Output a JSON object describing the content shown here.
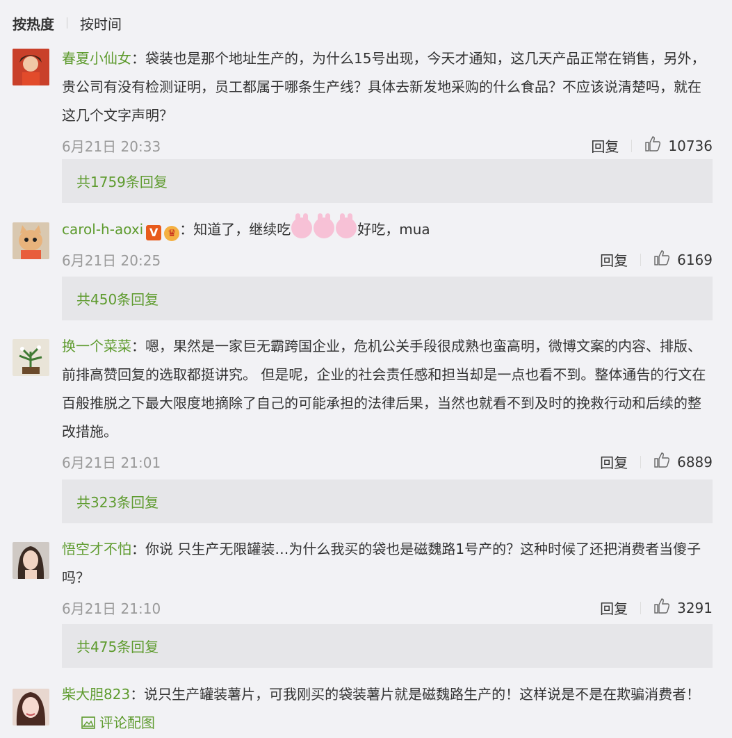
{
  "sort": {
    "active": "按热度",
    "inactive": "按时间"
  },
  "colors": {
    "username": "#5e9b2e",
    "background": "#f2f2f5",
    "reply_box": "#e6e6e9"
  },
  "comments": [
    {
      "user": "春夏小仙女",
      "text": "：袋装也是那个地址生产的，为什么15号出现，今天才通知，这几天产品正常在销售，另外，贵公司有没有检测证明，员工都属于哪条生产线？具体去新发地采购的什么食品？不应该说清楚吗，就在这几个文字声明？",
      "time": "6月21日 20:33",
      "reply_label": "回复",
      "likes": "10736",
      "replies": "共1759条回复"
    },
    {
      "user": "carol-h-aoxi",
      "text_before_emoji": "：知道了，继续吃",
      "text_after_emoji": "好吃，mua",
      "badge_v": "V",
      "time": "6月21日 20:25",
      "reply_label": "回复",
      "likes": "6169",
      "replies": "共450条回复"
    },
    {
      "user": "换一个菜菜",
      "text": "：嗯，果然是一家巨无霸跨国企业，危机公关手段很成熟也蛮高明，微博文案的内容、排版、前排高赞回复的选取都挺讲究。 但是呢，企业的社会责任感和担当却是一点也看不到。整体通告的行文在百般推脱之下最大限度地摘除了自己的可能承担的法律后果，当然也就看不到及时的挽救行动和后续的整改措施。",
      "time": "6月21日 21:01",
      "reply_label": "回复",
      "likes": "6889",
      "replies": "共323条回复"
    },
    {
      "user": "悟空才不怕",
      "text": "：你说 只生产无限罐装…为什么我买的袋也是磁魏路1号产的？这种时候了还把消费者当傻子吗？",
      "time": "6月21日 21:10",
      "reply_label": "回复",
      "likes": "3291",
      "replies": "共475条回复"
    },
    {
      "user": "柴大胆823",
      "text": "：说只生产罐装薯片，可我刚买的袋装薯片就是磁魏路生产的！这样说是不是在欺骗消费者！",
      "pic_link": "评论配图"
    }
  ]
}
